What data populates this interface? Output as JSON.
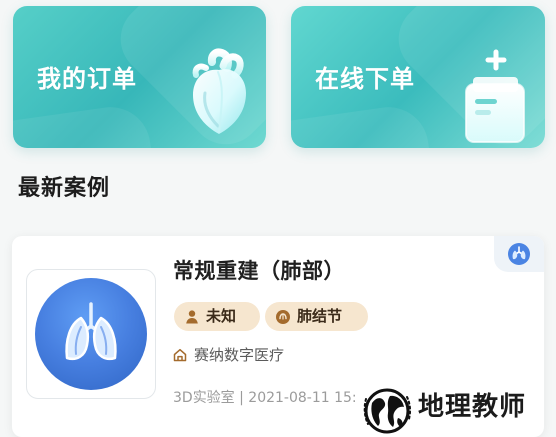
{
  "cards": {
    "my_orders": {
      "title": "我的订单",
      "icon": "heart-icon"
    },
    "online_order": {
      "title": "在线下单",
      "icon": "add-document-icon"
    }
  },
  "section": {
    "title": "最新案例"
  },
  "case": {
    "title": "常规重建（肺部）",
    "tags": [
      {
        "label": "未知",
        "icon": "person-icon"
      },
      {
        "label": "肺结节",
        "icon": "nodule-icon"
      }
    ],
    "hospital": {
      "name": "赛纳数字医疗",
      "icon": "home-icon"
    },
    "meta": "3D实验室 | 2021-08-11 15:",
    "thumbnail_icon": "lungs-icon",
    "corner_icon": "lungs-badge-icon"
  },
  "watermark": {
    "text": "地理教师"
  },
  "colors": {
    "card_teal": "#3fbcbc",
    "tag_background": "#f6e6cf",
    "thumbnail_blue": "#477fe0",
    "meta_gray": "#9b9b9b"
  }
}
